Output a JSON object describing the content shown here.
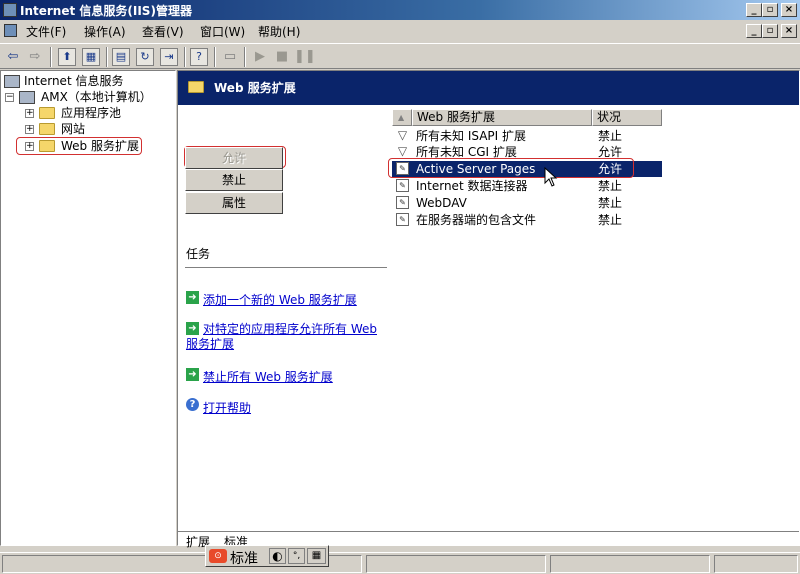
{
  "window": {
    "title": "Internet 信息服务(IIS)管理器",
    "minimize": "_",
    "maximize": "▫",
    "close": "×"
  },
  "menu": [
    "文件(F)",
    "操作(A)",
    "查看(V)",
    "窗口(W)",
    "帮助(H)"
  ],
  "tree": {
    "root": "Internet 信息服务",
    "computer": "AMX（本地计算机）",
    "children": [
      "应用程序池",
      "网站",
      "Web 服务扩展"
    ],
    "expander": "+",
    "collapse": "−"
  },
  "header": {
    "title": "Web 服务扩展"
  },
  "buttons": {
    "allow": "允许",
    "prohibit": "禁止",
    "properties": "属性"
  },
  "tasks": {
    "heading": "任务",
    "items": [
      "添加一个新的 Web 服务扩展",
      "对特定的应用程序允许所有 Web 服务扩展",
      "禁止所有 Web 服务扩展"
    ],
    "help": "打开帮助"
  },
  "list": {
    "columns": [
      "Web 服务扩展",
      "状况"
    ],
    "sort_glyph": "▲",
    "rows": [
      {
        "name": "所有未知 ISAPI 扩展",
        "status": "禁止"
      },
      {
        "name": "所有未知 CGI 扩展",
        "status": "允许"
      },
      {
        "name": "Active Server Pages",
        "status": "允许"
      },
      {
        "name": "Internet 数据连接器",
        "status": "禁止"
      },
      {
        "name": "WebDAV",
        "status": "禁止"
      },
      {
        "name": "在服务器端的包含文件",
        "status": "禁止"
      }
    ],
    "selected_index": 2
  },
  "tabs": [
    "扩展",
    "标准"
  ],
  "ime": {
    "label": "标准"
  },
  "colors": {
    "header_bg": "#0a246a",
    "highlight": "#d23030",
    "link": "#0000cc"
  }
}
